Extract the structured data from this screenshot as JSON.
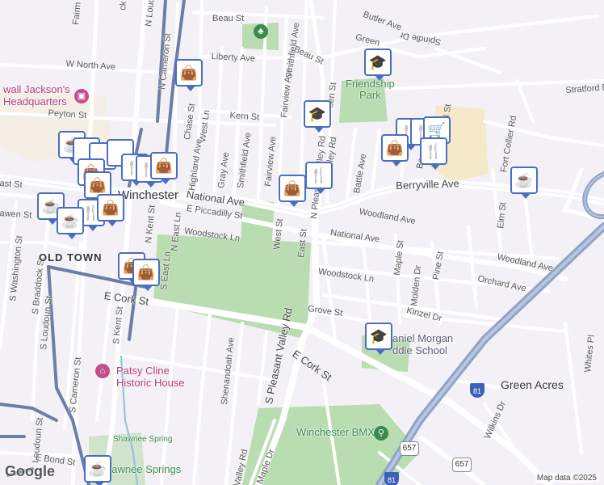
{
  "streets": {
    "beau_st_1": "Beau St",
    "beau_st_2": "Beau St",
    "butler_ave": "Butler Ave",
    "liberty_ave": "Liberty Ave",
    "w_north_ave": "W North Ave",
    "peyton_st": "Peyton St",
    "kern_st": "Kern St",
    "chase_st": "Chase St",
    "west_ln": "West Ln",
    "highland_ave": "Highland Ave",
    "gray_ave": "Gray Ave",
    "smithfield_ave_1": "Smithfield Ave",
    "smithfield_ave_2": "Smithfield Ave",
    "fairview_ave_1": "Fairview Ave",
    "fairview_ave_2": "Fairview Ave",
    "national_ave_1": "National Ave",
    "national_ave_2": "National Ave",
    "e_piccadilly_st": "E Piccadilly St",
    "woodstock_ln_1": "Woodstock Ln",
    "woodstock_ln_2": "Woodstock Ln",
    "berryville_ave": "Berryville Ave",
    "woodland_ave_1": "Woodland Ave",
    "woodland_ave_2": "Woodland Ave",
    "battle_ave": "Battle Ave",
    "maple_st": "Maple St",
    "pine_st": "Pine St",
    "orchard_ave": "Orchard Ave",
    "molden_dr": "Molden Dr",
    "kinzel_dr": "Kinzel Dr",
    "grove_st": "Grove St",
    "e_cork_st_1": "E Cork St",
    "e_cork_st_2": "E Cork St",
    "s_pleasant_valley_rd": "S Pleasant Valley Rd",
    "n_pleasant_valley_rd": "N Pleasant Valley Rd",
    "west_st": "West St",
    "east_st": "East St",
    "n_east_ln": "N East Ln",
    "s_east_ln": "S East Ln",
    "n_kent_st": "N Kent St",
    "s_kent_st": "S Kent St",
    "n_cameron_st": "N Cameron St",
    "s_cameron_st": "S Cameron St",
    "s_loudoun_st_1": "S Loudoun St",
    "s_loudoun_st_2": "Loudoun St",
    "s_braddock_st": "S Braddock St",
    "s_washington_st": "S Washington St",
    "shenandoah_ave": "Shenandoah Ave",
    "maple_dr": "Maple Dr",
    "e_bond_st": "E Bond St",
    "elm_st": "Elm St",
    "fort_collier_rd": "Fort Collier Rd",
    "stratford_dr": "Stratford D",
    "whites_pl": "Whites Pl",
    "wilkins_dr": "Wilkins Dr",
    "valley_rd": "Valley Rd",
    "n_loudoun": "N Loud",
    "fairmont": "Fairm",
    "rock_st": "ck St",
    "east_st_w": "ast St",
    "lawrence": "awen St",
    "greenwood": "Green",
    "sprindle": "Spindle Dr",
    "bay": "Ba",
    "well_st": "well St",
    "ven_st": "sen St",
    "ley_rd": "alley Rd"
  },
  "places": {
    "stonewall": "wall Jackson's",
    "headquarters": "Headquarters",
    "winchester": "Winchester",
    "old_town": "OLD TOWN",
    "friendship": "Friendship",
    "park": "Park",
    "daniel_morgan_1": "aniel Morgan",
    "daniel_morgan_2": "ddle School",
    "patsy_cline_1": "Patsy Cline",
    "patsy_cline_2": "Historic House",
    "winchester_bmx": "Winchester BMX",
    "green_acres": "Green Acres",
    "shawnee_spring": "Shawnee Spring",
    "shawnee_springs": "hawnee Springs"
  },
  "shields": {
    "i81_a": "81",
    "i81_b": "81",
    "route_657_a": "657",
    "route_657_b": "657"
  },
  "footer": {
    "logo": "Google",
    "attribution": "Map data ©2025"
  },
  "icons": {
    "shop": "shopping-bag-icon",
    "food": "fork-knife-icon",
    "cafe": "coffee-cup-icon",
    "school": "graduation-cap-icon",
    "grocery": "shopping-cart-icon",
    "museum": "museum-icon",
    "park": "tree-icon",
    "bmx": "bicycle-icon"
  },
  "colors": {
    "pin_border": "#4b6dc1",
    "park_green": "#b9dcb1",
    "highway": "#8fa4c8",
    "railway": "#5d6e97",
    "school_area": "#f6e9c9"
  }
}
